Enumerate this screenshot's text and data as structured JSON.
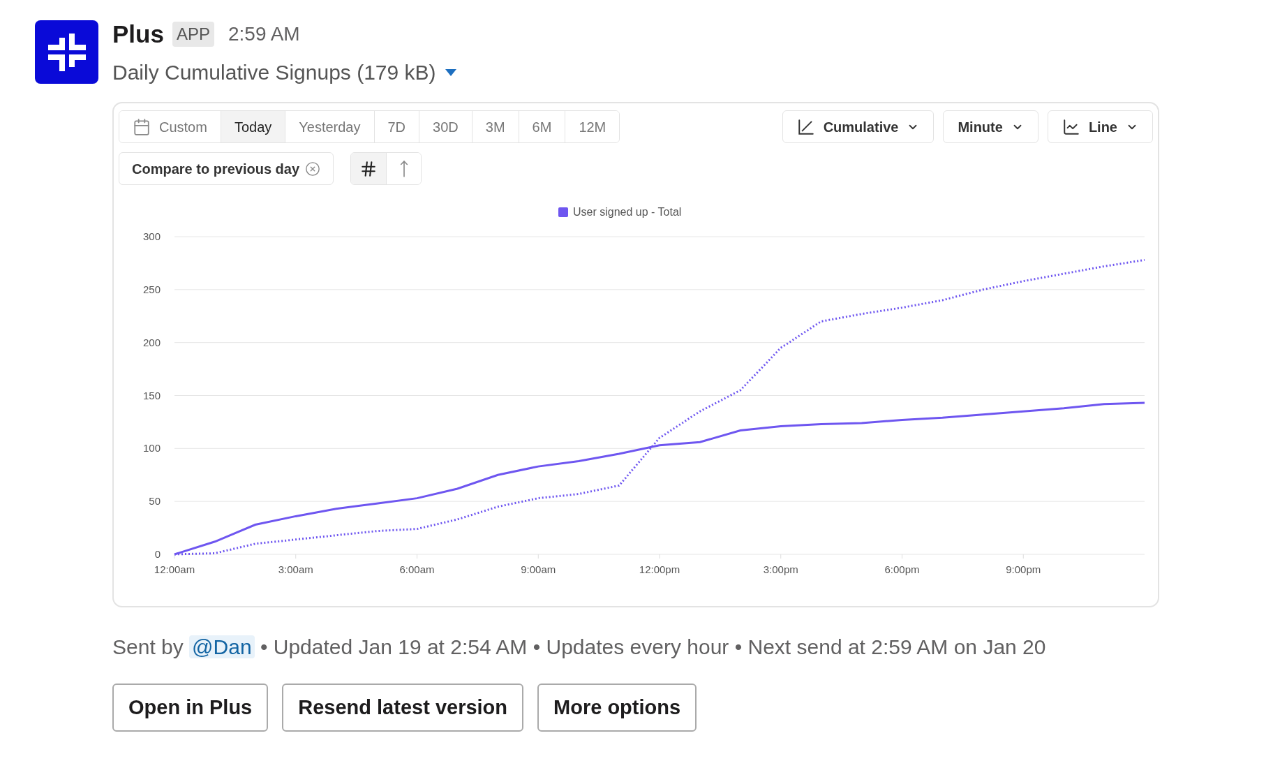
{
  "message": {
    "sender": "Plus",
    "badge": "APP",
    "time": "2:59 AM",
    "file_title": "Daily Cumulative Signups (179 kB)"
  },
  "periods": [
    {
      "label": "Custom",
      "kind": "custom",
      "selected": false
    },
    {
      "label": "Today",
      "kind": "preset",
      "selected": true
    },
    {
      "label": "Yesterday",
      "kind": "preset",
      "selected": false
    },
    {
      "label": "7D",
      "kind": "preset",
      "selected": false
    },
    {
      "label": "30D",
      "kind": "preset",
      "selected": false
    },
    {
      "label": "3M",
      "kind": "preset",
      "selected": false
    },
    {
      "label": "6M",
      "kind": "preset",
      "selected": false
    },
    {
      "label": "12M",
      "kind": "preset",
      "selected": false
    }
  ],
  "dropdowns": [
    {
      "label": "Cumulative",
      "kind": "cumulative"
    },
    {
      "label": "Minute",
      "kind": "plain"
    },
    {
      "label": "Line",
      "kind": "line"
    }
  ],
  "compare": {
    "label": "Compare to previous day"
  },
  "toggles": [
    {
      "kind": "hash",
      "selected": true
    },
    {
      "kind": "arrow",
      "selected": false
    }
  ],
  "chart": {
    "chart_data": {
      "type": "line",
      "x": [
        0,
        1,
        2,
        3,
        4,
        5,
        6,
        7,
        8,
        9,
        10,
        11,
        12,
        13,
        14,
        15,
        16,
        17,
        18,
        19,
        20,
        21,
        22,
        23,
        24
      ],
      "ylim": [
        0,
        300
      ],
      "xlim": [
        0,
        24
      ],
      "grid": true,
      "yticks": [
        0,
        50,
        100,
        150,
        200,
        250,
        300
      ],
      "xticks": [
        {
          "value": 0,
          "label": "12:00am"
        },
        {
          "value": 3,
          "label": "3:00am"
        },
        {
          "value": 6,
          "label": "6:00am"
        },
        {
          "value": 9,
          "label": "9:00am"
        },
        {
          "value": 12,
          "label": "12:00pm"
        },
        {
          "value": 15,
          "label": "3:00pm"
        },
        {
          "value": 18,
          "label": "6:00pm"
        },
        {
          "value": 21,
          "label": "9:00pm"
        }
      ],
      "series": [
        {
          "name": "User signed up - Total",
          "color": "#6e56f0",
          "line_style": "solid",
          "values": [
            0,
            12,
            28,
            36,
            43,
            48,
            53,
            62,
            75,
            83,
            88,
            95,
            103,
            106,
            117,
            121,
            123,
            124,
            127,
            129,
            132,
            135,
            138,
            142,
            143
          ]
        },
        {
          "color": "#6e56f0",
          "line_style": "dotted",
          "values": [
            0,
            1,
            10,
            14,
            18,
            22,
            24,
            33,
            45,
            53,
            57,
            65,
            110,
            135,
            155,
            195,
            220,
            227,
            233,
            240,
            250,
            258,
            265,
            272,
            278
          ]
        }
      ]
    }
  },
  "footer": {
    "prefix": "Sent by",
    "mention": "@Dan",
    "suffix": "• Updated Jan 19 at 2:54 AM • Updates every hour • Next send at 2:59 AM on Jan 20"
  },
  "buttons": [
    "Open in Plus",
    "Resend latest version",
    "More options"
  ]
}
